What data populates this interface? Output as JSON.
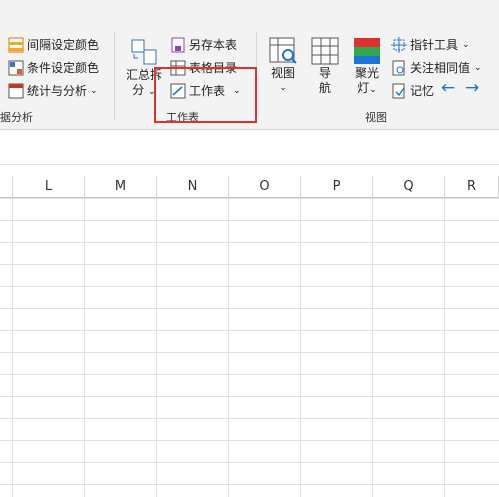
{
  "ribbon": {
    "left_group": {
      "items": [
        "间隔设定颜色",
        "条件设定颜色",
        "统计与分析"
      ],
      "label": "据分析"
    },
    "worksheet_group": {
      "summary_button": [
        "汇总拆",
        "分"
      ],
      "save_as_book": "另存本表",
      "sheet_index": "表格目录",
      "worksheet": "工作表",
      "label": "工作表"
    },
    "view_group": {
      "view": "视图",
      "navigate": [
        "导",
        "航"
      ],
      "spotlight": [
        "聚光",
        "灯"
      ],
      "pointer_tool": "指针工具",
      "focus_cell": "关注相同值",
      "memory": "记忆",
      "label": "视图"
    }
  },
  "columns": [
    "L",
    "M",
    "N",
    "O",
    "P",
    "Q",
    "R"
  ],
  "colors": {
    "highlight": "#e03131",
    "accent": "#1e73d8"
  }
}
